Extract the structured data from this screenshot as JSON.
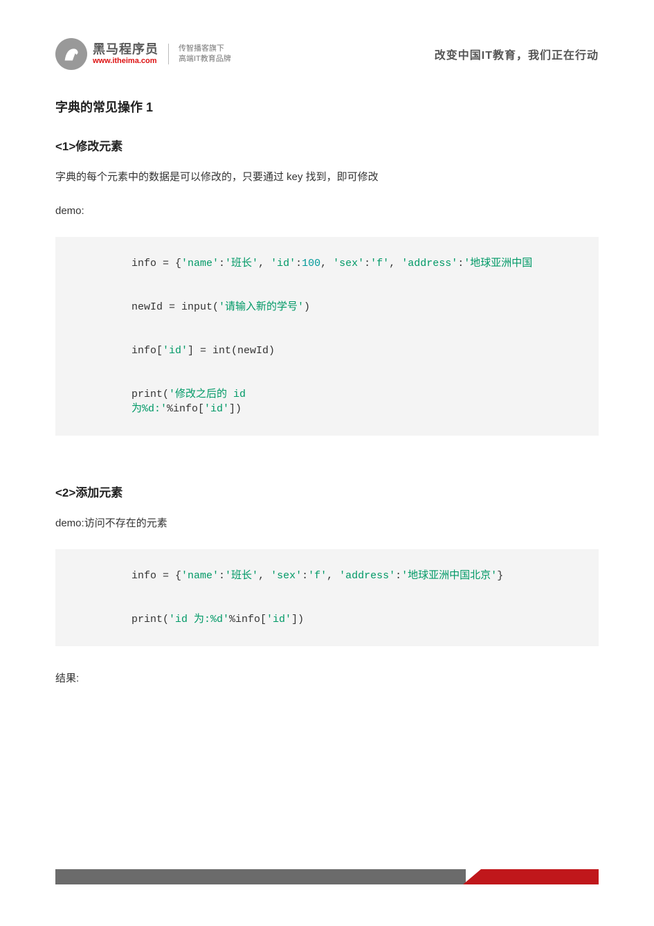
{
  "header": {
    "logo_title": "黑马程序员",
    "logo_url": "www.itheima.com",
    "logo_tag_line1": "传智播客旗下",
    "logo_tag_line2": "高端IT教育品牌",
    "slogan": "改变中国IT教育，我们正在行动"
  },
  "title": "字典的常⻅操作 1",
  "section1": {
    "heading": "<1>修改元素",
    "para": "字典的每个元素中的数据是可以修改的，只要通过 key 找到，即可修改",
    "demo_label": "demo:",
    "code": {
      "l1_pre": "info = {",
      "l1_k1": "'name'",
      "l1_c1": ":",
      "l1_v1": "'班长'",
      "l1_s1": ", ",
      "l1_k2": "'id'",
      "l1_c2": ":",
      "l1_v2": "100",
      "l1_s2": ", ",
      "l1_k3": "'sex'",
      "l1_c3": ":",
      "l1_v3": "'f'",
      "l1_s3": ", ",
      "l1_k4": "'address'",
      "l1_c4": ":",
      "l1_v4": "'地球亚洲中国",
      "l2_pre": "newId = input(",
      "l2_s": "'请输入新的学号'",
      "l2_post": ")",
      "l3_pre": "info[",
      "l3_k": "'id'",
      "l3_post": "] = int(newId)",
      "l4_pre": "print(",
      "l4_s1": "'修改之后的 id",
      "l4b_s2": "为%d:'",
      "l4b_mid": "%info[",
      "l4b_k": "'id'",
      "l4b_post": "])"
    }
  },
  "section2": {
    "heading": "<2>添加元素",
    "demo_label": "demo:访问不存在的元素",
    "code": {
      "l1_pre": "info = {",
      "l1_k1": "'name'",
      "l1_c1": ":",
      "l1_v1": "'班长'",
      "l1_s1": ", ",
      "l1_k2": "'sex'",
      "l1_c2": ":",
      "l1_v2": "'f'",
      "l1_s2": ", ",
      "l1_k3": "'address'",
      "l1_c3": ":",
      "l1_v3": "'地球亚洲中国北京'",
      "l1_post": "}",
      "l2_pre": "print(",
      "l2_s": "'id 为:%d'",
      "l2_mid": "%info[",
      "l2_k": "'id'",
      "l2_post": "])"
    },
    "result_label": "结果:"
  }
}
